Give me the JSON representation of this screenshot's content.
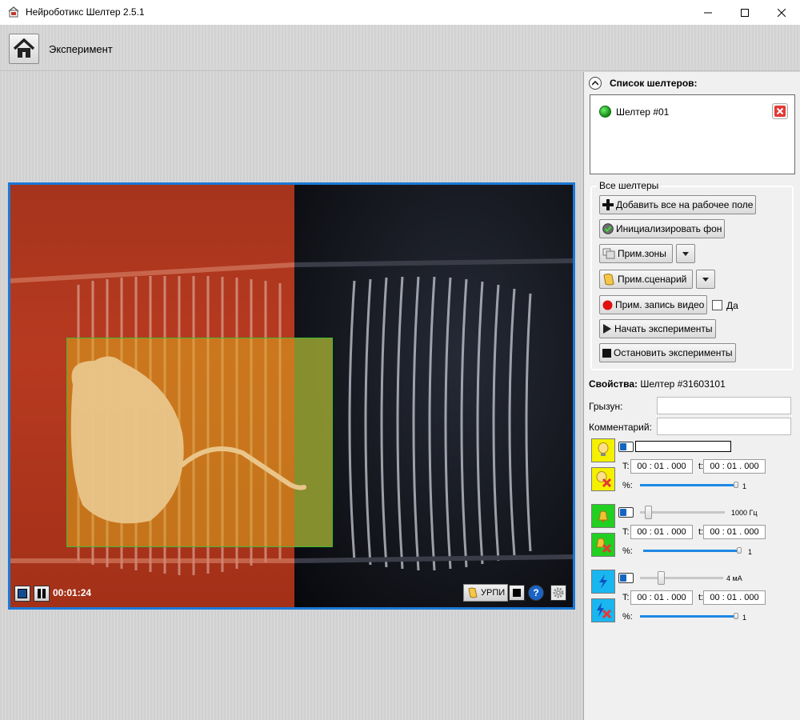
{
  "window": {
    "title": "Нейроботикс Шелтер 2.5.1",
    "icons": [
      "app-icon",
      "minimize-icon",
      "maximize-icon",
      "close-icon"
    ]
  },
  "toolbar": {
    "home_icon": "home-icon",
    "breadcrumb": "Эксперимент"
  },
  "video": {
    "timer": "00:01:24",
    "urpi_label": "УРПИ",
    "zone_colors": {
      "left": "#b73a20",
      "right": "#111319",
      "green": "#21804a",
      "rect_border": "#3dbb33"
    }
  },
  "sidebar": {
    "list_title": "Список шелтеров:",
    "shelters": [
      {
        "name": "Шелтер #01",
        "status_color": "#1fae1f"
      }
    ],
    "group_title": "Все шелтеры",
    "buttons": {
      "add_all": "Добавить все на рабочее поле",
      "init_bg": "Инициализировать фон",
      "apply_zones": "Прим.зоны",
      "apply_scenario": "Прим.сценарий",
      "apply_record": "Прим. запись видео",
      "record_yes": "Да",
      "start": "Начать эксперименты",
      "stop": "Остановить эксперименты"
    },
    "properties": {
      "label": "Свойства:",
      "shelter_name": "Шелтер #31603101",
      "rodent_label": "Грызун:",
      "rodent_value": "",
      "comment_label": "Комментарий:",
      "comment_value": ""
    },
    "devices": [
      {
        "name": "light",
        "on_icon": "light-bulb-icon",
        "off_icon": "light-bulb-off-icon",
        "color": "#f4f000",
        "t_label": "T:",
        "t_value": "00 : 01 . 000",
        "t2_label": "t:",
        "t2_value": "00 : 01 . 000",
        "percent_label": "%:",
        "percent_value": "1",
        "percent_fill": 1.0
      },
      {
        "name": "sound",
        "on_icon": "bell-icon",
        "off_icon": "bell-off-icon",
        "color": "#22d022",
        "freq_value": "1000 Гц",
        "freq_fill": 0.1,
        "t_label": "T:",
        "t_value": "00 : 01 . 000",
        "t2_label": "t:",
        "t2_value": "00 : 01 . 000",
        "percent_label": "%:",
        "percent_value": "1",
        "percent_fill": 1.0
      },
      {
        "name": "shock",
        "on_icon": "lightning-icon",
        "off_icon": "lightning-off-icon",
        "color": "#19b6f0",
        "current_value": "4 мА",
        "current_fill": 0.25,
        "t_label": "T:",
        "t_value": "00 : 01 . 000",
        "t2_label": "t:",
        "t2_value": "00 : 01 . 000",
        "percent_label": "%:",
        "percent_value": "1",
        "percent_fill": 1.0
      }
    ]
  }
}
